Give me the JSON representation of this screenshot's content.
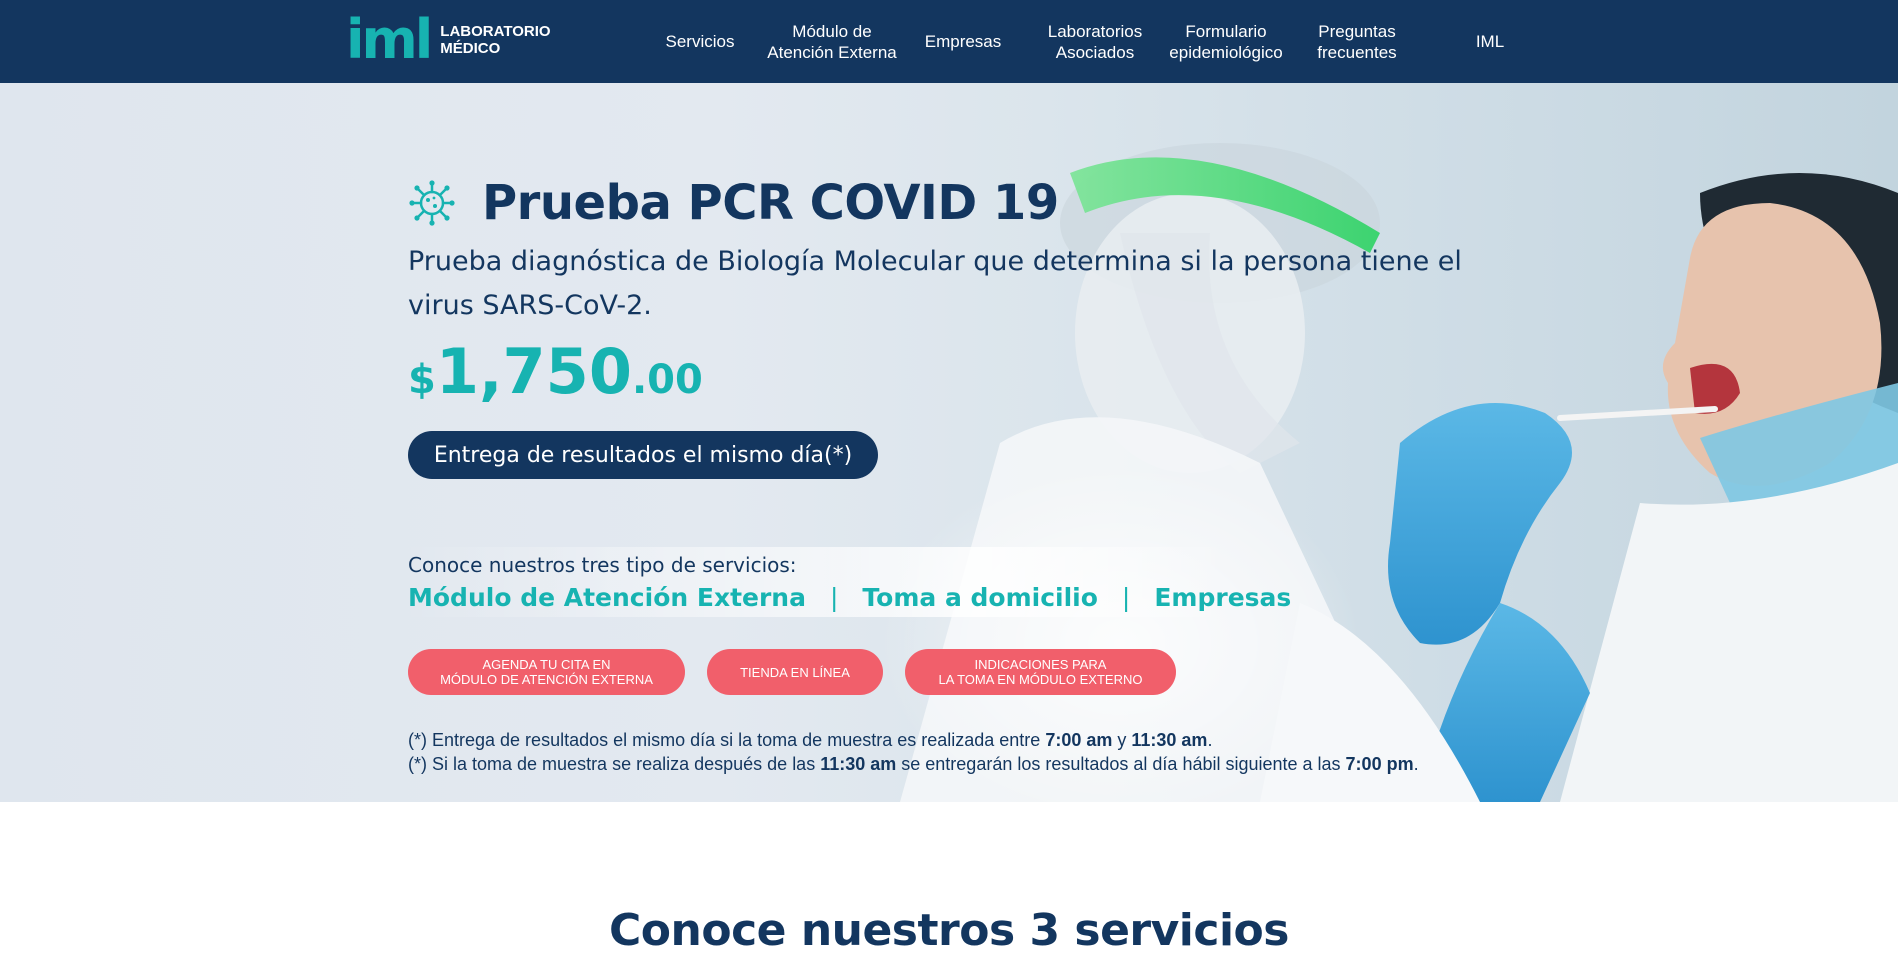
{
  "header": {
    "logo_mark": "iml",
    "logo_line1": "LABORATORIO",
    "logo_line2": "MÉDICO",
    "nav": [
      {
        "label": "Servicios"
      },
      {
        "label": "Módulo de\nAtención Externa"
      },
      {
        "label": "Empresas"
      },
      {
        "label": "Laboratorios\nAsociados"
      },
      {
        "label": "Formulario\nepidemiológico"
      },
      {
        "label": "Preguntas\nfrecuentes"
      },
      {
        "label": "IML"
      }
    ]
  },
  "hero": {
    "icon": "virus-icon",
    "title": "Prueba PCR COVID 19",
    "description": "Prueba diagnóstica de Biología Molecular que determina si la persona tiene el virus SARS-CoV-2.",
    "price_currency": "$",
    "price_main": "1,750",
    "price_cents": ".00",
    "results_button": "Entrega de resultados el mismo día(*)",
    "services_lead": "Conoce nuestros tres tipo de servicios:",
    "service_links": [
      "Módulo de Atención Externa",
      "Toma a domicilio",
      "Empresas"
    ],
    "separator": "|",
    "ctas": [
      {
        "line1": "AGENDA TU CITA EN",
        "line2": "MÓDULO DE ATENCIÓN EXTERNA"
      },
      {
        "line1": "TIENDA EN LÍNEA",
        "line2": ""
      },
      {
        "line1": "INDICACIONES PARA",
        "line2": "LA TOMA EN MÓDULO EXTERNO"
      }
    ],
    "note1": {
      "prefix": "(*) Entrega de resultados el mismo día si la toma de muestra es realizada entre ",
      "time1": "7:00 am",
      "mid": " y ",
      "time2": "11:30 am",
      "suffix": "."
    },
    "note2": {
      "prefix": "(*) Si la toma de muestra se realiza después de las ",
      "time1": "11:30 am",
      "mid": " se entregarán los resultados al día hábil siguiente a las ",
      "time2": "7:00 pm",
      "suffix": "."
    }
  },
  "services_section": {
    "title": "Conoce nuestros 3 servicios"
  },
  "colors": {
    "navy": "#13365f",
    "teal": "#17b3b1",
    "coral": "#f15f6b",
    "glove_blue": "#3aa6dc"
  }
}
